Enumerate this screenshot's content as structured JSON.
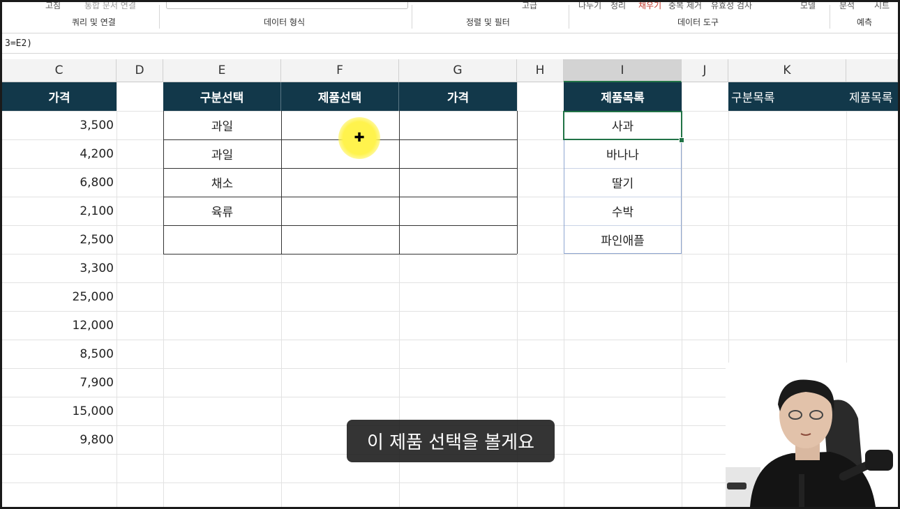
{
  "ribbon": {
    "top_fragments": [
      "고침",
      "통합 문서 연결",
      "고급",
      "나누기",
      "정리",
      "채우기",
      "중복 제거",
      "유효성 검사",
      "모델",
      "분석",
      "시트"
    ],
    "groups": [
      "쿼리 및 연결",
      "데이터 형식",
      "정렬 및 필터",
      "데이터 도구",
      "예측"
    ]
  },
  "formula_bar": {
    "text": "3=E2)"
  },
  "columns": [
    "C",
    "D",
    "E",
    "F",
    "G",
    "H",
    "I",
    "J",
    "K"
  ],
  "selected_column": "I",
  "price_column": {
    "header": "가격",
    "values": [
      "3,500",
      "4,200",
      "6,800",
      "2,100",
      "2,500",
      "3,300",
      "25,000",
      "12,000",
      "8,500",
      "7,900",
      "15,000",
      "9,800"
    ]
  },
  "selection_table": {
    "headers": [
      "구분선택",
      "제품선택",
      "가격"
    ],
    "categories": [
      "과일",
      "과일",
      "채소",
      "육류",
      ""
    ]
  },
  "product_list": {
    "header": "제품목록",
    "items": [
      "사과",
      "바나나",
      "딸기",
      "수박",
      "파인애플"
    ]
  },
  "extra_headers": {
    "category_list": "구분목록",
    "product_list2": "제품목록"
  },
  "subtitle": "이 제품 선택을 볼게요",
  "colors": {
    "header_bg": "#12384a",
    "selection": "#217346",
    "cursor_highlight": "#fff34d"
  }
}
